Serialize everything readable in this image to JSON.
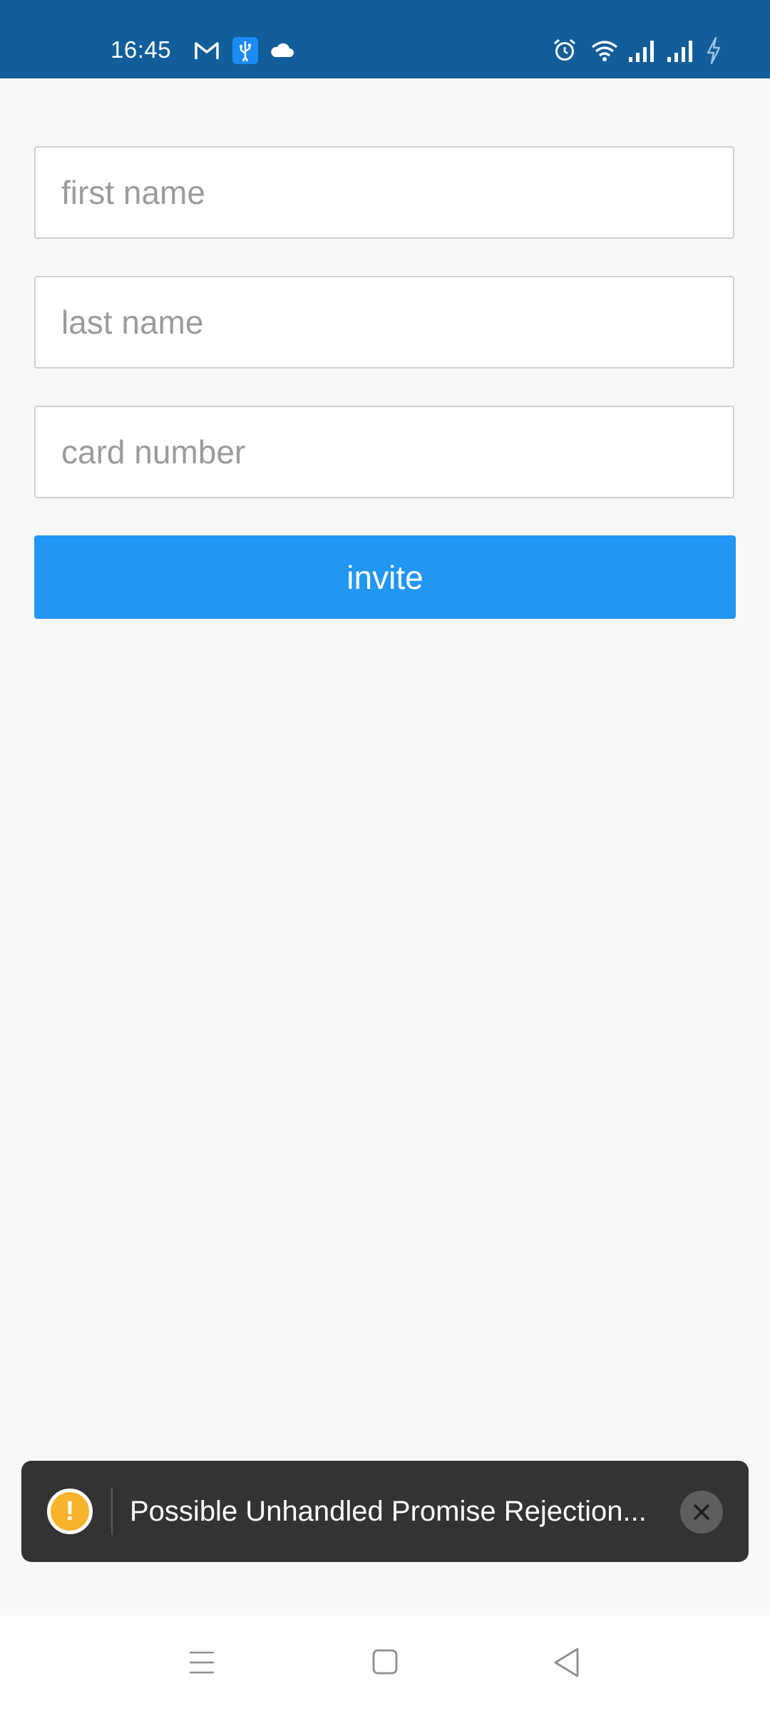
{
  "status_bar": {
    "time": "16:45",
    "left_icons": [
      "gmail-icon",
      "usb-icon",
      "cloud-icon"
    ],
    "right_icons": [
      "alarm-icon",
      "wifi-icon",
      "signal-icon",
      "signal-icon",
      "charging-icon"
    ],
    "background_color": "#125e9a"
  },
  "form": {
    "first_name_placeholder": "first name",
    "last_name_placeholder": "last name",
    "card_number_placeholder": "card number",
    "first_name_value": "",
    "last_name_value": "",
    "card_number_value": "",
    "invite_label": "invite",
    "button_color": "#2196f3"
  },
  "toast": {
    "icon": "warning-icon",
    "message": "Possible Unhandled Promise Rejection...",
    "close_icon": "close-icon",
    "background_color": "#333333"
  },
  "nav_bar": {
    "icons": [
      "menu-icon",
      "home-icon",
      "back-icon"
    ]
  }
}
